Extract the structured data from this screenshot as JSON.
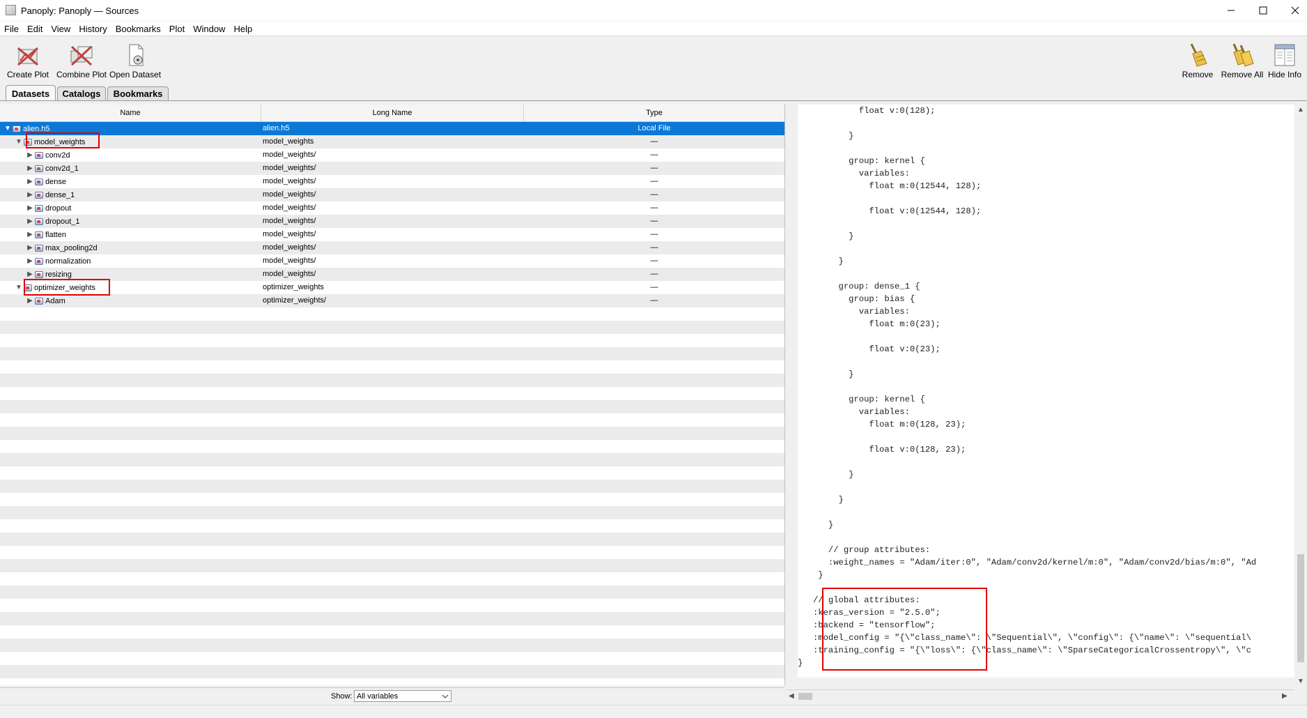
{
  "window": {
    "title": "Panoply: Panoply — Sources"
  },
  "menu": [
    "File",
    "Edit",
    "View",
    "History",
    "Bookmarks",
    "Plot",
    "Window",
    "Help"
  ],
  "toolbar": {
    "create_plot": "Create Plot",
    "combine_plot": "Combine Plot",
    "open_dataset": "Open Dataset",
    "remove": "Remove",
    "remove_all": "Remove All",
    "hide_info": "Hide Info"
  },
  "tabs": [
    "Datasets",
    "Catalogs",
    "Bookmarks"
  ],
  "table": {
    "columns": [
      "Name",
      "Long Name",
      "Type"
    ],
    "rows": [
      {
        "name": "alien.h5",
        "long": "alien.h5",
        "type": "Local File",
        "level": 0,
        "expanded": true
      },
      {
        "name": "model_weights",
        "long": "model_weights",
        "type": "—",
        "level": 1,
        "expanded": true
      },
      {
        "name": "conv2d",
        "long": "model_weights/",
        "type": "—",
        "level": 2,
        "expanded": false
      },
      {
        "name": "conv2d_1",
        "long": "model_weights/",
        "type": "—",
        "level": 2,
        "expanded": false
      },
      {
        "name": "dense",
        "long": "model_weights/",
        "type": "—",
        "level": 2,
        "expanded": false
      },
      {
        "name": "dense_1",
        "long": "model_weights/",
        "type": "—",
        "level": 2,
        "expanded": false
      },
      {
        "name": "dropout",
        "long": "model_weights/",
        "type": "—",
        "level": 2,
        "expanded": false
      },
      {
        "name": "dropout_1",
        "long": "model_weights/",
        "type": "—",
        "level": 2,
        "expanded": false
      },
      {
        "name": "flatten",
        "long": "model_weights/",
        "type": "—",
        "level": 2,
        "expanded": false
      },
      {
        "name": "max_pooling2d",
        "long": "model_weights/",
        "type": "—",
        "level": 2,
        "expanded": false
      },
      {
        "name": "normalization",
        "long": "model_weights/",
        "type": "—",
        "level": 2,
        "expanded": false
      },
      {
        "name": "resizing",
        "long": "model_weights/",
        "type": "—",
        "level": 2,
        "expanded": false
      },
      {
        "name": "optimizer_weights",
        "long": "optimizer_weights",
        "type": "—",
        "level": 1,
        "expanded": true
      },
      {
        "name": "Adam",
        "long": "optimizer_weights/",
        "type": "—",
        "level": 2,
        "expanded": false
      }
    ]
  },
  "show": {
    "label": "Show:",
    "value": "All variables"
  },
  "info_text": [
    "            float v:0(128);",
    "",
    "          }",
    "",
    "          group: kernel {",
    "            variables:",
    "              float m:0(12544, 128);",
    "",
    "              float v:0(12544, 128);",
    "",
    "          }",
    "",
    "        }",
    "",
    "        group: dense_1 {",
    "          group: bias {",
    "            variables:",
    "              float m:0(23);",
    "",
    "              float v:0(23);",
    "",
    "          }",
    "",
    "          group: kernel {",
    "            variables:",
    "              float m:0(128, 23);",
    "",
    "              float v:0(128, 23);",
    "",
    "          }",
    "",
    "        }",
    "",
    "      }",
    "",
    "      // group attributes:",
    "      :weight_names = \"Adam/iter:0\", \"Adam/conv2d/kernel/m:0\", \"Adam/conv2d/bias/m:0\", \"Ad",
    "    }",
    "",
    "   // global attributes:",
    "   :keras_version = \"2.5.0\";",
    "   :backend = \"tensorflow\";",
    "   :model_config = \"{\\\"class_name\\\": \\\"Sequential\\\", \\\"config\\\": {\\\"name\\\": \\\"sequential\\",
    "   :training_config = \"{\\\"loss\\\": {\\\"class_name\\\": \\\"SparseCategoricalCrossentropy\\\", \\\"c",
    "}"
  ],
  "colors": {
    "selection": "#0b78d7",
    "highlight_box": "#e00000",
    "alt_row": "#ebebeb"
  }
}
